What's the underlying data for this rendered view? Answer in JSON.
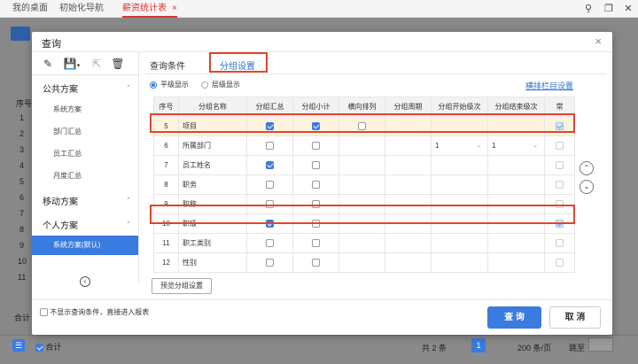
{
  "tabs": [
    {
      "label": "我的桌面"
    },
    {
      "label": "初始化导航"
    },
    {
      "label": "薪资统计表",
      "close": "×"
    }
  ],
  "topbar_icons": [
    "search-icon",
    "copy-icon",
    "close-icon"
  ],
  "background": {
    "left_labels": [
      "序号",
      "1",
      "2",
      "3",
      "4",
      "5",
      "6",
      "7",
      "8",
      "9",
      "10",
      "11",
      "合计"
    ],
    "footer": {
      "sum_label": "合计",
      "total": "共 2 条",
      "page": "1",
      "page_size": "200 条/页",
      "jump_label": "跳至"
    }
  },
  "modal": {
    "title": "查询",
    "close": "×",
    "left_groups": [
      {
        "label": "公共方案",
        "items": [
          "系统方案",
          "部门汇总",
          "员工汇总",
          "月度汇总"
        ]
      },
      {
        "label": "移动方案",
        "items": []
      },
      {
        "label": "个人方案",
        "items": [
          "系统方案(默认)"
        ]
      }
    ],
    "tabs": [
      "查询条件",
      "分组设置"
    ],
    "display_modes": [
      "平级显示",
      "层级显示"
    ],
    "link": "横排栏目设置",
    "columns": [
      "序号",
      "分组名称",
      "分组汇总",
      "分组小计",
      "横向排列",
      "分组周期",
      "分组开始级次",
      "分组结束级次",
      "常"
    ],
    "rows": [
      {
        "no": "5",
        "name": "项目",
        "sum": true,
        "subtotal": true,
        "horizontal": false,
        "period": "",
        "start": "",
        "end": "",
        "common": true,
        "highlight": true
      },
      {
        "no": "6",
        "name": "所属部门",
        "sum": false,
        "subtotal": false,
        "horizontal": null,
        "period": "",
        "start": "1",
        "end": "1",
        "common": false,
        "highlight": false
      },
      {
        "no": "7",
        "name": "员工姓名",
        "sum": true,
        "subtotal": false,
        "horizontal": null,
        "period": "",
        "start": "",
        "end": "",
        "common": false,
        "highlight": false
      },
      {
        "no": "8",
        "name": "职务",
        "sum": false,
        "subtotal": false,
        "horizontal": null,
        "period": "",
        "start": "",
        "end": "",
        "common": false,
        "highlight": false
      },
      {
        "no": "9",
        "name": "职称",
        "sum": false,
        "subtotal": false,
        "horizontal": null,
        "period": "",
        "start": "",
        "end": "",
        "common": false,
        "highlight": false
      },
      {
        "no": "10",
        "name": "职级",
        "sum": true,
        "subtotal": false,
        "horizontal": null,
        "period": "",
        "start": "",
        "end": "",
        "common": true,
        "highlight": false
      },
      {
        "no": "11",
        "name": "职工类别",
        "sum": false,
        "subtotal": false,
        "horizontal": null,
        "period": "",
        "start": "",
        "end": "",
        "common": false,
        "highlight": false
      },
      {
        "no": "12",
        "name": "性别",
        "sum": false,
        "subtotal": false,
        "horizontal": null,
        "period": "",
        "start": "",
        "end": "",
        "common": false,
        "highlight": false
      }
    ],
    "preview_button": "预览分组设置",
    "skip_checkbox_label": "不显示查询条件，直接进入报表",
    "query_button": "查 询",
    "cancel_button": "取 消"
  }
}
